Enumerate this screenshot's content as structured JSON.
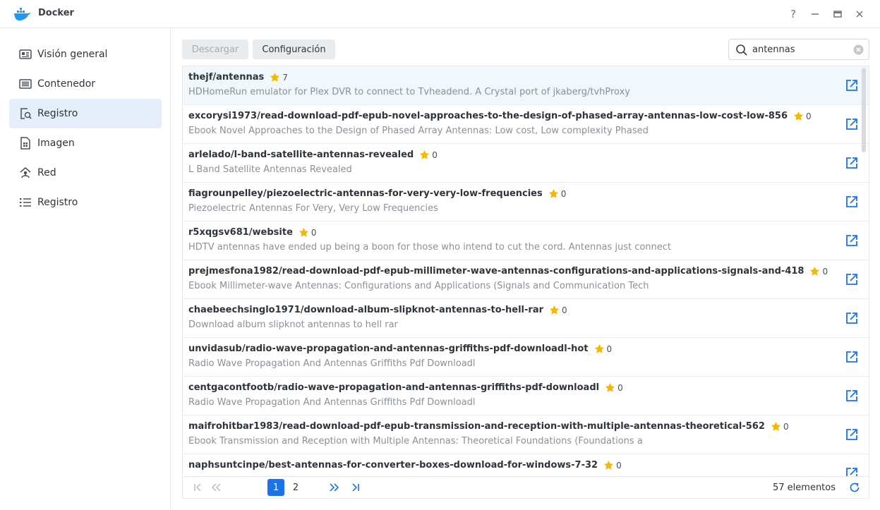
{
  "window": {
    "title": "Docker",
    "help_label": "?",
    "minimize_label": "—",
    "maximize_label": "▭",
    "close_label": "✕"
  },
  "sidebar": {
    "items": [
      {
        "label": "Visión general",
        "icon": "overview-icon",
        "active": false
      },
      {
        "label": "Contenedor",
        "icon": "container-icon",
        "active": false
      },
      {
        "label": "Registro",
        "icon": "registry-search-icon",
        "active": true
      },
      {
        "label": "Imagen",
        "icon": "image-icon",
        "active": false
      },
      {
        "label": "Red",
        "icon": "network-icon",
        "active": false
      },
      {
        "label": "Registro",
        "icon": "log-list-icon",
        "active": false
      }
    ]
  },
  "toolbar": {
    "download_label": "Descargar",
    "settings_label": "Configuración"
  },
  "search": {
    "value": "antennas",
    "placeholder": ""
  },
  "results": [
    {
      "name": "thejf/antennas",
      "stars": "7",
      "description": "HDHomeRun emulator for Plex DVR to connect to Tvheadend. A Crystal port of jkaberg/tvhProxy"
    },
    {
      "name": "excorysi1973/read-download-pdf-epub-novel-approaches-to-the-design-of-phased-array-antennas-low-cost-low-856",
      "stars": "0",
      "description": "Ebook Novel Approaches to the Design of Phased Array Antennas: Low cost, Low complexity Phased"
    },
    {
      "name": "arlelado/l-band-satellite-antennas-revealed",
      "stars": "0",
      "description": "L Band Satellite Antennas Revealed"
    },
    {
      "name": "fiagrounpelley/piezoelectric-antennas-for-very-very-low-frequencies",
      "stars": "0",
      "description": "Piezoelectric Antennas For Very, Very Low Frequencies"
    },
    {
      "name": "r5xqgsv681/website",
      "stars": "0",
      "description": "HDTV antennas have ended up being a boon for those who intend to cut the cord. Antennas just connect"
    },
    {
      "name": "prejmesfona1982/read-download-pdf-epub-millimeter-wave-antennas-configurations-and-applications-signals-and-418",
      "stars": "0",
      "description": "Ebook Millimeter-wave Antennas: Configurations and Applications (Signals and Communication Tech"
    },
    {
      "name": "chaebeechsinglo1971/download-album-slipknot-antennas-to-hell-rar",
      "stars": "0",
      "description": "Download album slipknot antennas to hell rar"
    },
    {
      "name": "unvidasub/radio-wave-propagation-and-antennas-griffiths-pdf-downloadl-hot",
      "stars": "0",
      "description": "Radio Wave Propagation And Antennas Griffiths Pdf Downloadl"
    },
    {
      "name": "centgacontfootb/radio-wave-propagation-and-antennas-griffiths-pdf-downloadl",
      "stars": "0",
      "description": "Radio Wave Propagation And Antennas Griffiths Pdf Downloadl"
    },
    {
      "name": "maifrohitbar1983/read-download-pdf-epub-transmission-and-reception-with-multiple-antennas-theoretical-562",
      "stars": "0",
      "description": "Ebook Transmission and Reception with Multiple Antennas: Theoretical Foundations (Foundations a"
    },
    {
      "name": "naphsuntcinpe/best-antennas-for-converter-boxes-download-for-windows-7-32",
      "stars": "0",
      "description": ""
    }
  ],
  "pagination": {
    "current_page": "1",
    "next_page": "2",
    "total_label": "57 elementos"
  },
  "colors": {
    "accent": "#1a73e8",
    "star": "#f5b800",
    "active_nav_bg": "#e5effb"
  }
}
